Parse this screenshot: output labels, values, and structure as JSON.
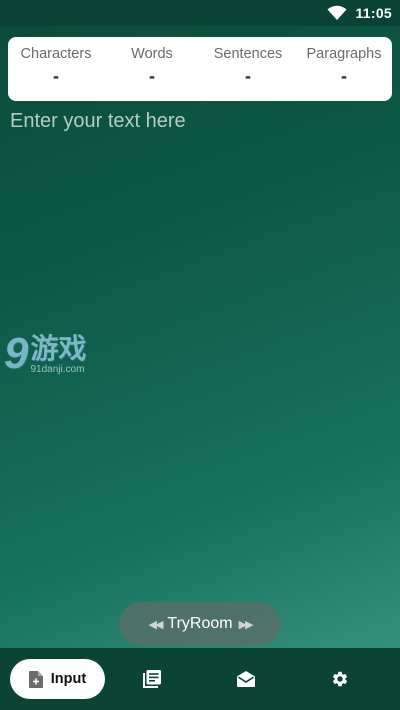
{
  "status_bar": {
    "time": "11:05",
    "icons": [
      "wifi-icon"
    ]
  },
  "stats": [
    {
      "label": "Characters",
      "value": "-"
    },
    {
      "label": "Words",
      "value": "-"
    },
    {
      "label": "Sentences",
      "value": "-"
    },
    {
      "label": "Paragraphs",
      "value": "-"
    }
  ],
  "editor": {
    "placeholder": "Enter your text here",
    "value": ""
  },
  "watermark": {
    "logo": "9",
    "chinese_text": "游戏",
    "domain": "91danji.com"
  },
  "tryroom": {
    "label": "TryRoom",
    "left_icon": "rewind-icon",
    "right_icon": "fast-forward-icon"
  },
  "bottom_nav": {
    "items": [
      {
        "id": "input",
        "label": "Input",
        "icon": "document-add-icon",
        "active": true
      },
      {
        "id": "library",
        "icon": "library-icon",
        "active": false
      },
      {
        "id": "inbox",
        "icon": "envelope-open-icon",
        "active": false
      },
      {
        "id": "settings",
        "icon": "gear-icon",
        "active": false
      }
    ]
  },
  "colors": {
    "background_top": "#0b4a3a",
    "background_bottom": "#3f9985",
    "nav_background": "#0b4435",
    "card_background": "#ffffff"
  }
}
